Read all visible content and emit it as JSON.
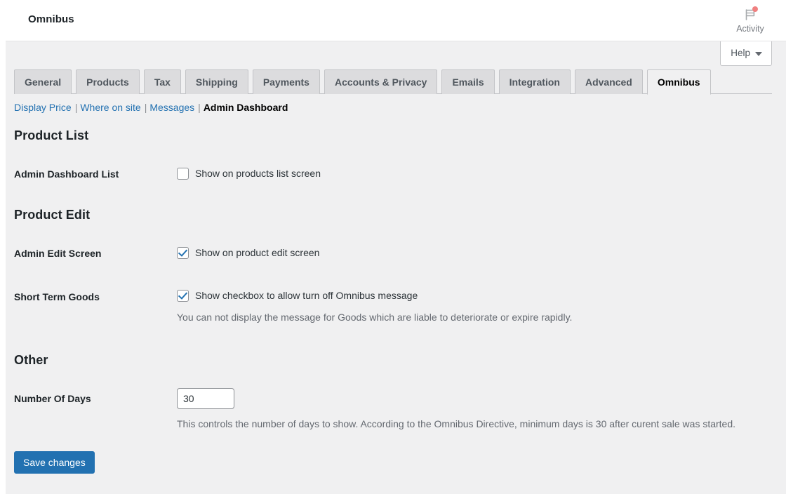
{
  "header": {
    "site_title": "Omnibus",
    "activity": {
      "label": "Activity",
      "icon": "flag-icon",
      "badge_color": "#f08080"
    }
  },
  "help": {
    "label": "Help",
    "caret_icon": "chevron-down-icon"
  },
  "tabs": [
    {
      "label": "General",
      "active": false
    },
    {
      "label": "Products",
      "active": false
    },
    {
      "label": "Tax",
      "active": false
    },
    {
      "label": "Shipping",
      "active": false
    },
    {
      "label": "Payments",
      "active": false
    },
    {
      "label": "Accounts & Privacy",
      "active": false
    },
    {
      "label": "Emails",
      "active": false
    },
    {
      "label": "Integration",
      "active": false
    },
    {
      "label": "Advanced",
      "active": false
    },
    {
      "label": "Omnibus",
      "active": true
    }
  ],
  "subnav": [
    {
      "label": "Display Price",
      "current": false
    },
    {
      "label": "Where on site",
      "current": false
    },
    {
      "label": "Messages",
      "current": false
    },
    {
      "label": "Admin Dashboard",
      "current": true
    }
  ],
  "sections": {
    "product_list": {
      "title": "Product List",
      "row": {
        "label": "Admin Dashboard List",
        "checkbox_label": "Show on products list screen",
        "checked": false
      }
    },
    "product_edit": {
      "title": "Product Edit",
      "row_admin_edit": {
        "label": "Admin Edit Screen",
        "checkbox_label": "Show on product edit screen",
        "checked": true
      },
      "row_short_term": {
        "label": "Short Term Goods",
        "checkbox_label": "Show checkbox to allow turn off Omnibus message",
        "checked": true,
        "description": "You can not display the message for Goods which are liable to deteriorate or expire rapidly."
      }
    },
    "other": {
      "title": "Other",
      "row_days": {
        "label": "Number Of Days",
        "value": "30",
        "placeholder": "",
        "description": "This controls the number of days to show. According to the Omnibus Directive, minimum days is 30 after curent sale was started."
      }
    }
  },
  "footer": {
    "save_label": "Save changes"
  },
  "colors": {
    "accent": "#2271b1",
    "page_bg": "#f0f0f1",
    "tab_bg": "#dcdcde",
    "border": "#c3c4c7"
  }
}
